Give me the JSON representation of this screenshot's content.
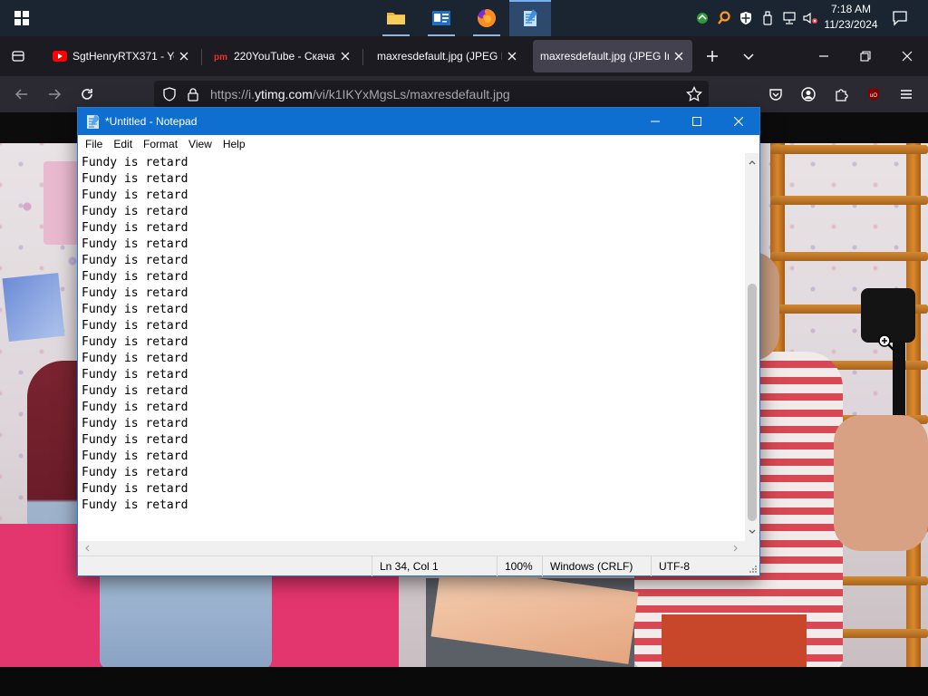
{
  "taskbar": {
    "clock_time": "7:18 AM",
    "clock_date": "11/23/2024"
  },
  "browser": {
    "tabs": [
      {
        "title": "SgtHenryRTX371 - YouTube",
        "favicon": "youtube-icon",
        "active": false
      },
      {
        "title": "220YouTube - Скачать",
        "favicon": "pm-icon",
        "active": false
      },
      {
        "title": "maxresdefault.jpg (JPEG Image",
        "favicon": "none",
        "active": false
      },
      {
        "title": "maxresdefault.jpg (JPEG Image",
        "favicon": "none",
        "active": true
      }
    ],
    "url_prefix": "https://i.",
    "url_domain": "ytimg.com",
    "url_path": "/vi/k1IKYxMgsLs/maxresdefault.jpg"
  },
  "notepad": {
    "title": "*Untitled - Notepad",
    "menu": [
      "File",
      "Edit",
      "Format",
      "View",
      "Help"
    ],
    "lines": [
      "Fundy is retard",
      "Fundy is retard",
      "Fundy is retard",
      "Fundy is retard",
      "Fundy is retard",
      "Fundy is retard",
      "Fundy is retard",
      "Fundy is retard",
      "Fundy is retard",
      "Fundy is retard",
      "Fundy is retard",
      "Fundy is retard",
      "Fundy is retard",
      "Fundy is retard",
      "Fundy is retard",
      "Fundy is retard",
      "Fundy is retard",
      "Fundy is retard",
      "Fundy is retard",
      "Fundy is retard",
      "Fundy is retard",
      "Fundy is retard"
    ],
    "status": {
      "position": "Ln 34, Col 1",
      "zoom": "100%",
      "line_ending": "Windows (CRLF)",
      "encoding": "UTF-8"
    }
  },
  "colors": {
    "notepad_titlebar": "#0f6fd0",
    "taskbar": "#1a2531",
    "browser_tabbar": "#1c1b22"
  }
}
